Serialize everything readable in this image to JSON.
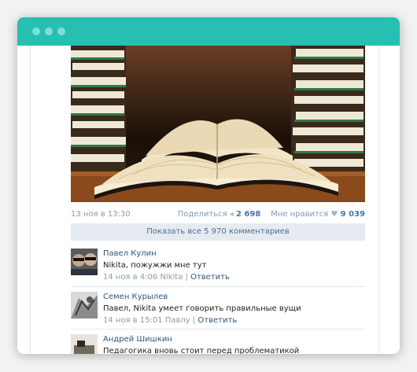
{
  "post": {
    "date": "13 ноя в 13:30",
    "share_label": "Поделиться",
    "share_count": "2 698",
    "like_label": "Мне нравится",
    "like_count": "9 039",
    "share_icon": "megaphone-icon",
    "like_icon": "heart-icon"
  },
  "show_all_comments": "Показать все 5 970 комментариев",
  "comments": [
    {
      "author": "Павел Кулин",
      "text": "Nikita, пожужжи мне тут",
      "meta": "14 ноя в 4:06 Nikita",
      "reply": "Ответить"
    },
    {
      "author": "Семен Курылев",
      "text": "Павел, Nikita умеет говорить правильные вущи",
      "meta": "14 ноя в 15:01 Павлу",
      "reply": "Ответить"
    },
    {
      "author": "Андрей Шишкин",
      "text": "Педагогика вновь стоит перед проблематикой необходимости выработки соответствующей концепции и образовательных стратегий, что проехали ещё"
    }
  ],
  "colors": {
    "titlebar": "#26bfb1",
    "link": "#2b587a",
    "muted": "#8e9aa8"
  }
}
